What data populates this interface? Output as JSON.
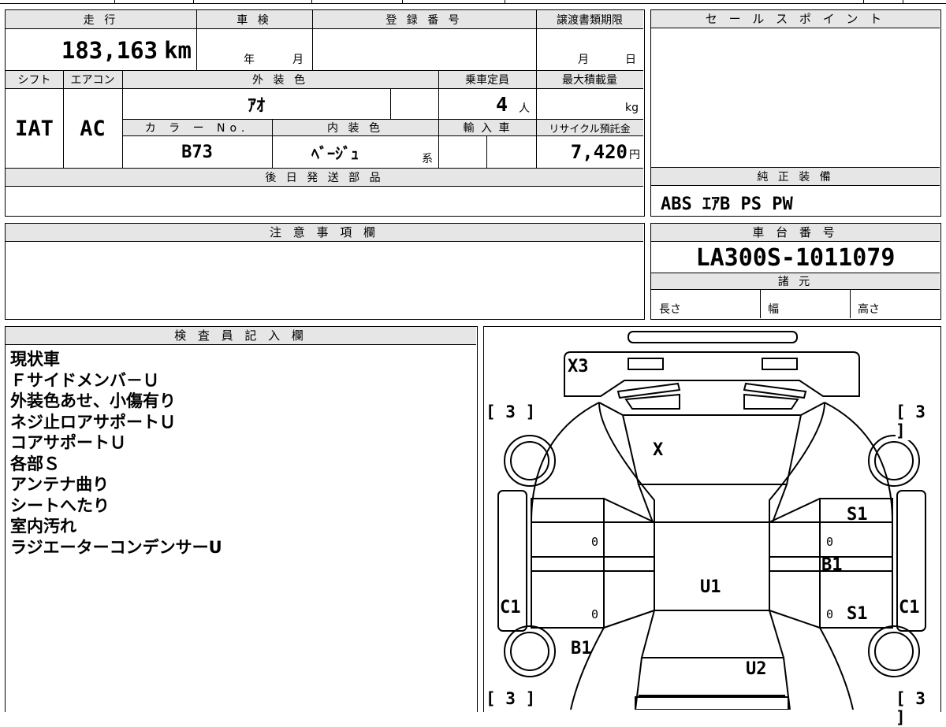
{
  "mileage": {
    "label": "走 行",
    "value": "183,163",
    "unit": "km"
  },
  "inspection": {
    "label": "車 検",
    "year_unit": "年",
    "month_unit": "月"
  },
  "registration": {
    "label": "登 録 番 号",
    "value": ""
  },
  "transfer_deadline": {
    "label": "譲渡書類期限",
    "month_unit": "月",
    "day_unit": "日"
  },
  "sales_point": {
    "label": "セ ー ル ス ポ イ ン ト",
    "value": ""
  },
  "shift": {
    "label": "シフト",
    "value": "IAT"
  },
  "aircon": {
    "label": "エアコン",
    "value": "AC"
  },
  "exterior_color": {
    "label": "外 装 色",
    "value": "ｱｵ"
  },
  "capacity": {
    "label": "乗車定員",
    "value": "4",
    "unit": "人"
  },
  "max_load": {
    "label": "最大積載量",
    "value": "",
    "unit": "kg"
  },
  "color_no": {
    "label": "カ ラ ー No.",
    "value": "B73"
  },
  "interior_color": {
    "label": "内 装 色",
    "value": "ﾍﾞｰｼﾞｭ",
    "suffix": "系"
  },
  "import": {
    "label": "輸 入 車",
    "value": ""
  },
  "recycle": {
    "label": "リサイクル預託金",
    "value": "7,420",
    "unit": "円"
  },
  "later_parts": {
    "label": "後 日 発 送 部 品",
    "value": ""
  },
  "genuine_equipment": {
    "label": "純 正 装 備",
    "value": "ABS ｴｱB PS PW"
  },
  "notes": {
    "label": "注 意 事 項 欄",
    "value": ""
  },
  "chassis": {
    "label": "車 台 番 号",
    "value": "LA300S-1011079"
  },
  "specs": {
    "label": "諸 元",
    "length": "長さ",
    "width": "幅",
    "height": "高さ"
  },
  "inspector": {
    "label": "検 査 員 記 入 欄",
    "lines": [
      "現状車",
      "Ｆサイドメンバ－Ｕ",
      "外装色あせ、小傷有り",
      "ネジ止ロアサポートＵ",
      "コアサポートＵ",
      "各部Ｓ",
      "アンテナ曲り",
      "シートへたり",
      "室内汚れ",
      "ラジエーターコンデンサーU"
    ]
  },
  "diagram": {
    "marks": {
      "x3": "X3",
      "x": "X",
      "s1_top": "S1",
      "s1_bottom": "S1",
      "b1_right": "B1",
      "b1_left": "B1",
      "u1": "U1",
      "u2": "U2",
      "c1_left": "C1",
      "c1_right": "C1"
    },
    "tires": {
      "front_left": "[ 3 ]",
      "front_right": "[ 3 ]",
      "rear_left": "[ 3 ]",
      "rear_right": "[ 3 ]"
    },
    "zeros": {
      "left_top": "0",
      "left_bottom": "0",
      "right_top": "0",
      "right_bottom": "0"
    }
  }
}
